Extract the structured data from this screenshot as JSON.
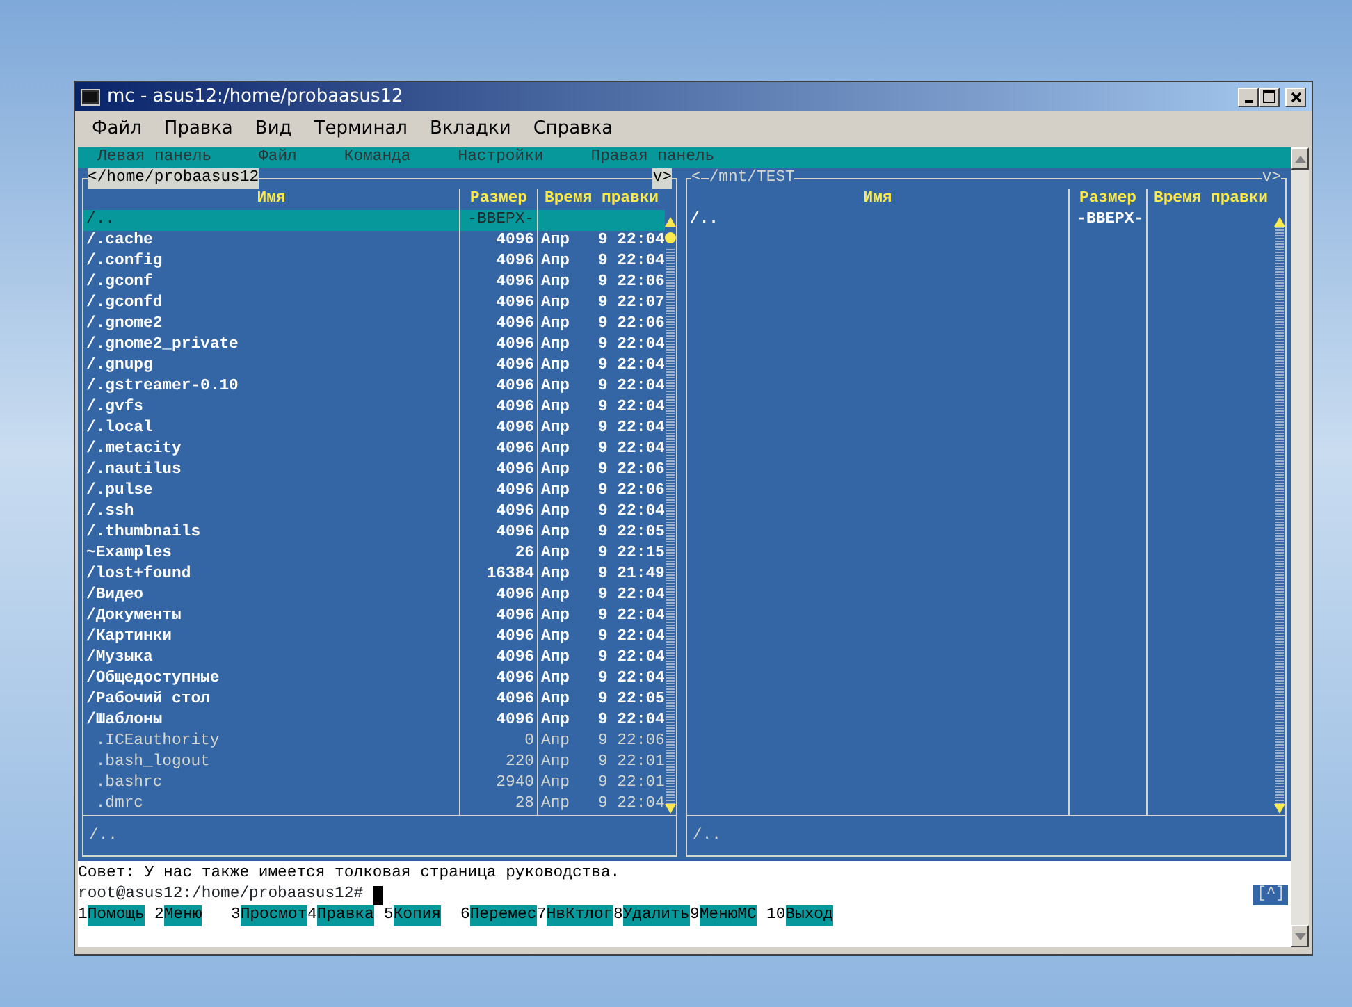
{
  "window": {
    "title": "mc - asus12:/home/probaasus12"
  },
  "menubar": [
    "Файл",
    "Правка",
    "Вид",
    "Терминал",
    "Вкладки",
    "Справка"
  ],
  "mc_menu": [
    "Левая панель",
    "Файл",
    "Команда",
    "Настройки",
    "Правая панель"
  ],
  "panels": [
    {
      "active": true,
      "nav_left": "<",
      "path": "/home/probaasus12",
      "nav_right": "v>",
      "columns": [
        "Имя",
        "Размер",
        "Время правки"
      ],
      "rows": [
        {
          "name": "/..",
          "size": "-ВВЕРХ-",
          "kind": "dir",
          "selected": true
        },
        {
          "name": "/.cache",
          "size": "4096",
          "time": "Апр   9 22:04",
          "kind": "dir",
          "selected": false
        },
        {
          "name": "/.config",
          "size": "4096",
          "time": "Апр   9 22:04",
          "kind": "dir",
          "selected": false
        },
        {
          "name": "/.gconf",
          "size": "4096",
          "time": "Апр   9 22:06",
          "kind": "dir",
          "selected": false
        },
        {
          "name": "/.gconfd",
          "size": "4096",
          "time": "Апр   9 22:07",
          "kind": "dir",
          "selected": false
        },
        {
          "name": "/.gnome2",
          "size": "4096",
          "time": "Апр   9 22:06",
          "kind": "dir",
          "selected": false
        },
        {
          "name": "/.gnome2_private",
          "size": "4096",
          "time": "Апр   9 22:04",
          "kind": "dir",
          "selected": false
        },
        {
          "name": "/.gnupg",
          "size": "4096",
          "time": "Апр   9 22:04",
          "kind": "dir",
          "selected": false
        },
        {
          "name": "/.gstreamer-0.10",
          "size": "4096",
          "time": "Апр   9 22:04",
          "kind": "dir",
          "selected": false
        },
        {
          "name": "/.gvfs",
          "size": "4096",
          "time": "Апр   9 22:04",
          "kind": "dir",
          "selected": false
        },
        {
          "name": "/.local",
          "size": "4096",
          "time": "Апр   9 22:04",
          "kind": "dir",
          "selected": false
        },
        {
          "name": "/.metacity",
          "size": "4096",
          "time": "Апр   9 22:04",
          "kind": "dir",
          "selected": false
        },
        {
          "name": "/.nautilus",
          "size": "4096",
          "time": "Апр   9 22:06",
          "kind": "dir",
          "selected": false
        },
        {
          "name": "/.pulse",
          "size": "4096",
          "time": "Апр   9 22:06",
          "kind": "dir",
          "selected": false
        },
        {
          "name": "/.ssh",
          "size": "4096",
          "time": "Апр   9 22:04",
          "kind": "dir",
          "selected": false
        },
        {
          "name": "/.thumbnails",
          "size": "4096",
          "time": "Апр   9 22:05",
          "kind": "dir",
          "selected": false
        },
        {
          "name": "~Examples",
          "size": "26",
          "time": "Апр   9 22:15",
          "kind": "dir",
          "selected": false
        },
        {
          "name": "/lost+found",
          "size": "16384",
          "time": "Апр   9 21:49",
          "kind": "dir",
          "selected": false
        },
        {
          "name": "/Видео",
          "size": "4096",
          "time": "Апр   9 22:04",
          "kind": "dir",
          "selected": false
        },
        {
          "name": "/Документы",
          "size": "4096",
          "time": "Апр   9 22:04",
          "kind": "dir",
          "selected": false
        },
        {
          "name": "/Картинки",
          "size": "4096",
          "time": "Апр   9 22:04",
          "kind": "dir",
          "selected": false
        },
        {
          "name": "/Музыка",
          "size": "4096",
          "time": "Апр   9 22:04",
          "kind": "dir",
          "selected": false
        },
        {
          "name": "/Общедоступные",
          "size": "4096",
          "time": "Апр   9 22:04",
          "kind": "dir",
          "selected": false
        },
        {
          "name": "/Рабочий стол",
          "size": "4096",
          "time": "Апр   9 22:05",
          "kind": "dir",
          "selected": false
        },
        {
          "name": "/Шаблоны",
          "size": "4096",
          "time": "Апр   9 22:04",
          "kind": "dir",
          "selected": false
        },
        {
          "name": " .ICEauthority",
          "size": "0",
          "time": "Апр   9 22:06",
          "kind": "file",
          "selected": false
        },
        {
          "name": " .bash_logout",
          "size": "220",
          "time": "Апр   9 22:01",
          "kind": "file",
          "selected": false
        },
        {
          "name": " .bashrc",
          "size": "2940",
          "time": "Апр   9 22:01",
          "kind": "file",
          "selected": false
        },
        {
          "name": " .dmrc",
          "size": "28",
          "time": "Апр   9 22:04",
          "kind": "file",
          "selected": false
        }
      ],
      "status": "/.."
    },
    {
      "active": false,
      "nav_left": "<",
      "path": "/mnt/TEST",
      "nav_right": "v>",
      "columns": [
        "Имя",
        "Размер",
        "Время правки"
      ],
      "rows": [
        {
          "name": "/..",
          "size": "-ВВЕРХ-",
          "kind": "dir",
          "selected": false
        }
      ],
      "status": "/.."
    }
  ],
  "hint": "Совет: У нас также имеется толковая страница руководства.",
  "prompt": "root@asus12:/home/probaasus12#",
  "prompt_badge": "[^]",
  "keys": [
    {
      "number": "1",
      "label": "Помощь"
    },
    {
      "number": "2",
      "label": "Меню"
    },
    {
      "number": "3",
      "label": "Просмот"
    },
    {
      "number": "4",
      "label": "Правка"
    },
    {
      "number": "5",
      "label": "Копия"
    },
    {
      "number": "6",
      "label": "Перемес"
    },
    {
      "number": "7",
      "label": "НвКтлог"
    },
    {
      "number": "8",
      "label": "Удалить"
    },
    {
      "number": "9",
      "label": "МенюМС"
    },
    {
      "number": "10",
      "label": "Выход"
    }
  ]
}
